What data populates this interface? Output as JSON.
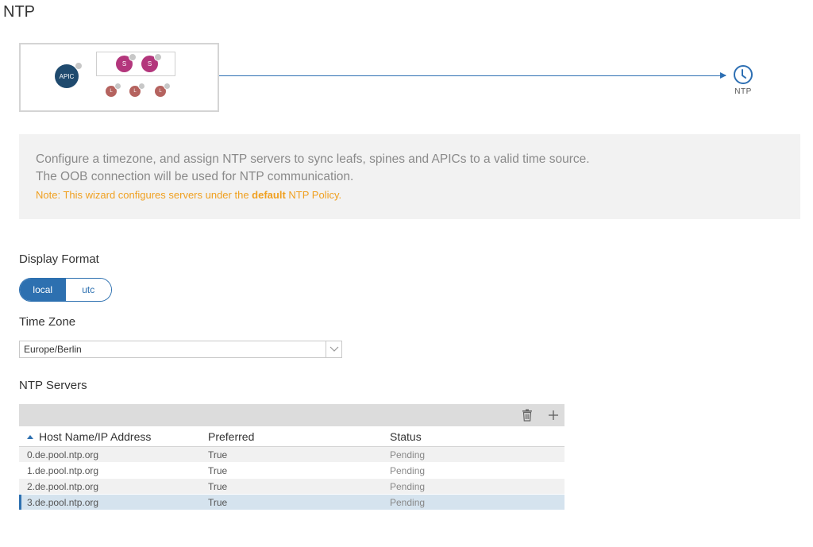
{
  "page": {
    "title": "NTP"
  },
  "diagram": {
    "apic_label": "APIC",
    "spine_label": "S",
    "leaf_label": "L",
    "target_label": "NTP"
  },
  "info": {
    "line1": "Configure a timezone, and assign NTP servers to sync leafs, spines and APICs to a valid time source.",
    "line2": "The OOB connection will be used for NTP communication.",
    "note_prefix": "Note: This wizard configures servers under the ",
    "note_bold": "default",
    "note_suffix": " NTP Policy."
  },
  "display_format": {
    "label": "Display Format",
    "options": [
      "local",
      "utc"
    ],
    "selected": "local"
  },
  "time_zone": {
    "label": "Time Zone",
    "value": "Europe/Berlin"
  },
  "ntp_servers": {
    "label": "NTP Servers",
    "columns": [
      "Host Name/IP Address",
      "Preferred",
      "Status"
    ],
    "rows": [
      {
        "host": "0.de.pool.ntp.org",
        "preferred": "True",
        "status": "Pending"
      },
      {
        "host": "1.de.pool.ntp.org",
        "preferred": "True",
        "status": "Pending"
      },
      {
        "host": "2.de.pool.ntp.org",
        "preferred": "True",
        "status": "Pending"
      },
      {
        "host": "3.de.pool.ntp.org",
        "preferred": "True",
        "status": "Pending"
      }
    ]
  },
  "colors": {
    "accent": "#2d70b0",
    "apic": "#1f4a6e",
    "spine": "#b3367c",
    "leaf": "#b5635f",
    "note": "#f0a020"
  }
}
